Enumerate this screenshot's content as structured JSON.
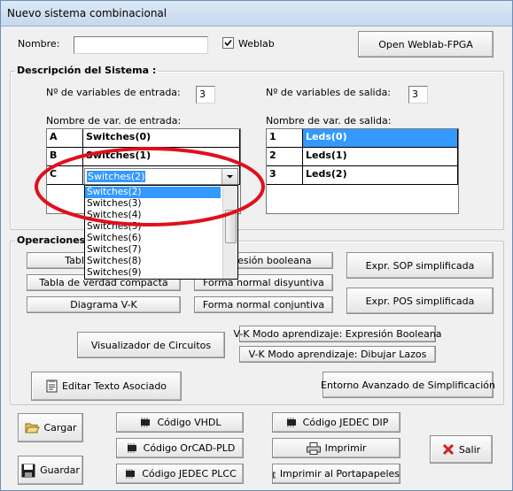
{
  "window": {
    "title": "Nuevo sistema combinacional"
  },
  "top": {
    "name_label": "Nombre:",
    "name_value": "",
    "weblab_checkbox_label": "Weblab",
    "weblab_checked": true,
    "open_weblab_button": "Open Weblab-FPGA"
  },
  "descripcion": {
    "title": "Descripción del Sistema :",
    "num_inputs_label": "Nº de variables de entrada:",
    "num_inputs_value": "3",
    "num_outputs_label": "Nº de variables de salida:",
    "num_outputs_value": "3",
    "input_names_label": "Nombre de var. de entrada:",
    "output_names_label": "Nombre de var. de salida:",
    "inputs": [
      {
        "letter": "A",
        "name": "Switches(0)"
      },
      {
        "letter": "B",
        "name": "Switches(1)"
      },
      {
        "letter": "C",
        "name": "Switches(2)"
      }
    ],
    "outputs": [
      {
        "index": "1",
        "name": "Leds(0)"
      },
      {
        "index": "2",
        "name": "Leds(1)"
      },
      {
        "index": "3",
        "name": "Leds(2)"
      }
    ],
    "dropdown_options": [
      "Switches(2)",
      "Switches(3)",
      "Switches(4)",
      "Switches(5)",
      "Switches(6)",
      "Switches(7)",
      "Switches(8)",
      "Switches(9)"
    ],
    "dropdown_selected": "Switches(2)"
  },
  "operaciones": {
    "title": "Operaciones",
    "tabla_verdad": "Tabla de verdad",
    "expresion_booleana": "Expresión booleana",
    "tabla_compacta": "Tabla de verdad compacta",
    "forma_disyuntiva": "Forma normal disyuntiva",
    "diagrama_vk": "Diagrama V-K",
    "forma_conjuntiva": "Forma normal conjuntiva",
    "expr_sop": "Expr. SOP simplificada",
    "expr_pos": "Expr. POS simplificada",
    "visualizador": "Visualizador de Circuitos",
    "vk_expresion": "V-K Modo aprendizaje: Expresión Booleana",
    "vk_lazos": "V-K Modo aprendizaje: Dibujar Lazos",
    "editar_texto": "Editar Texto Asociado",
    "entorno_avanzado": "Entorno Avanzado de Simplificación"
  },
  "bottom": {
    "cargar": "Cargar",
    "guardar": "Guardar",
    "codigo_vhdl": "Código VHDL",
    "codigo_orcad": "Código OrCAD-PLD",
    "codigo_plcc": "Código JEDEC PLCC",
    "codigo_dip": "Código JEDEC DIP",
    "imprimir": "Imprimir",
    "imprimir_portapapeles": "Imprimir al Portapapeles",
    "salir": "Salir"
  },
  "colors": {
    "selection": "#3399ff",
    "annotation_ellipse": "#e0101c"
  }
}
